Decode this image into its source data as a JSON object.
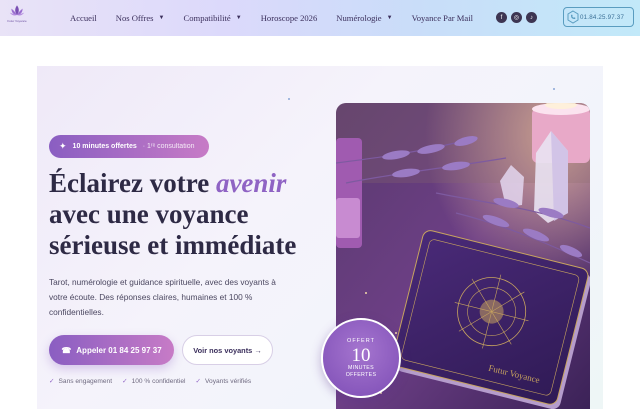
{
  "brand": {
    "logo_text": "Futur Voyance"
  },
  "nav": {
    "items": [
      {
        "label": "Accueil",
        "dropdown": false
      },
      {
        "label": "Nos Offres",
        "dropdown": true
      },
      {
        "label": "Compatibilité",
        "dropdown": true
      },
      {
        "label": "Horoscope 2026",
        "dropdown": false
      },
      {
        "label": "Numérologie",
        "dropdown": true
      },
      {
        "label": "Voyance Par Mail",
        "dropdown": false
      }
    ],
    "socials": [
      "facebook-icon",
      "instagram-icon",
      "tiktok-icon"
    ],
    "phone": "01.84.25.97.37"
  },
  "hero": {
    "badge_main": "10 minutes offertes",
    "badge_sub": "· 1ʳᵉ consultation",
    "title_part1": "Éclairez votre ",
    "title_accent": "avenir",
    "title_part2": "avec une voyance sérieuse et immédiate",
    "lead": "Tarot, numérologie et guidance spirituelle, avec des voyants à votre écoute. Des réponses claires, humaines et 100 % confidentielles.",
    "cta_call": "Appeler 01 84 25 97 37",
    "cta_see": "Voir nos voyants →",
    "trust": [
      "Sans engagement",
      "100 % confidentiel",
      "Voyants vérifiés"
    ],
    "card_text": "Futur Voyance"
  },
  "offer": {
    "line1": "OFFERT",
    "number": "10",
    "line3": "MINUTES",
    "line4": "OFFERTES"
  },
  "colors": {
    "accent": "#8f63c4",
    "accent2": "#c77bc6",
    "text": "#2e2a45"
  }
}
